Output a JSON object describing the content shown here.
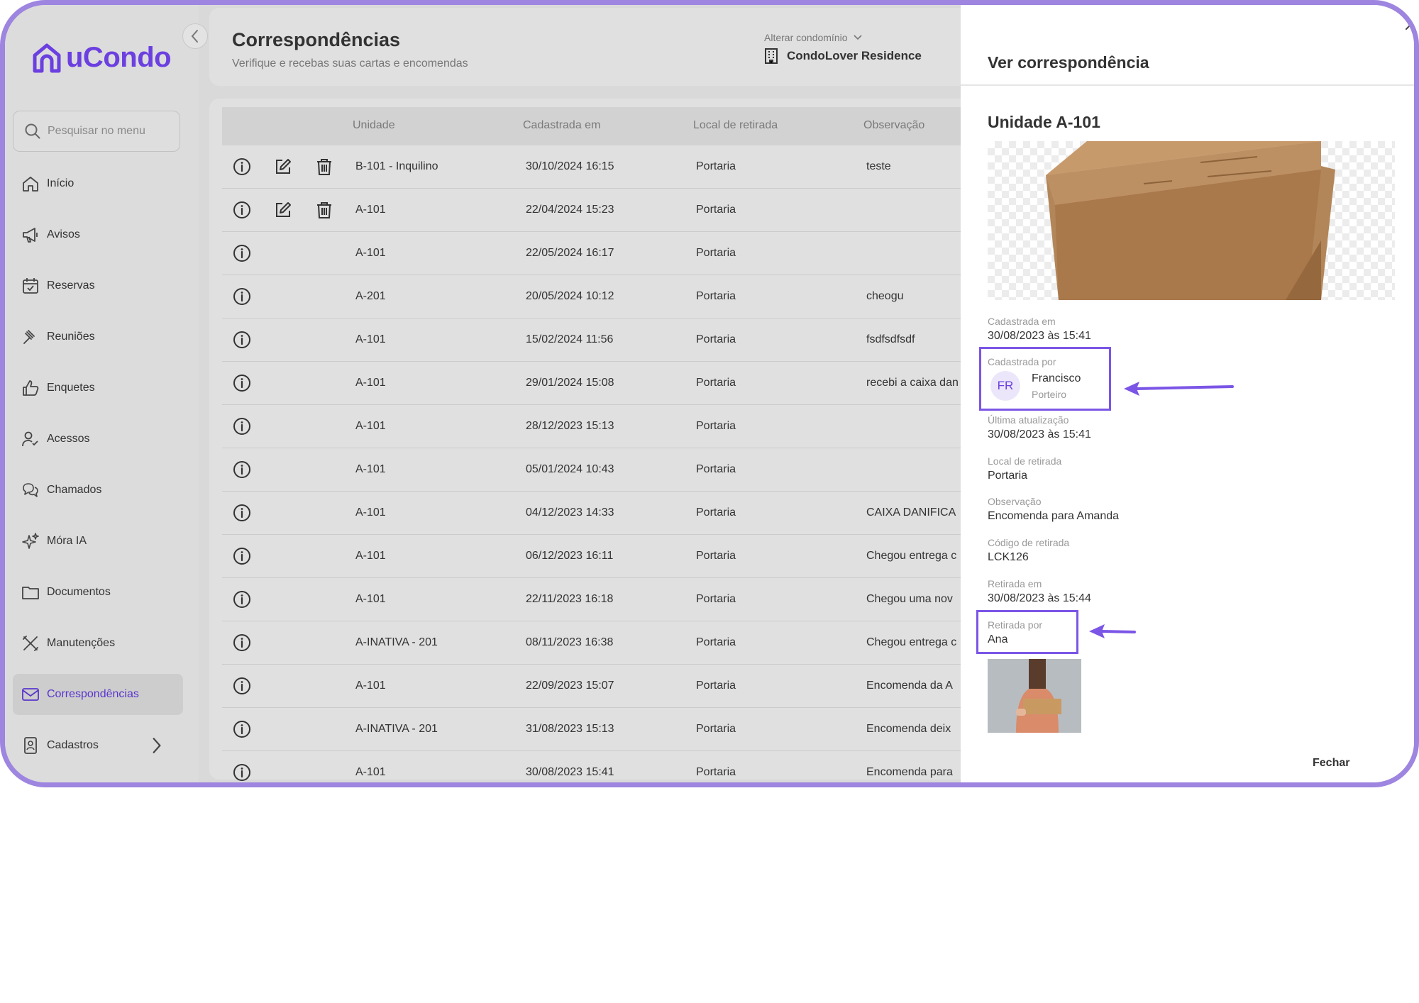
{
  "app": {
    "logo_text": "uCondo"
  },
  "sidebar": {
    "search_placeholder": "Pesquisar no menu",
    "items": [
      {
        "label": "Início",
        "icon": "home-icon"
      },
      {
        "label": "Avisos",
        "icon": "megaphone-icon"
      },
      {
        "label": "Reservas",
        "icon": "calendar-icon"
      },
      {
        "label": "Reuniões",
        "icon": "gavel-icon"
      },
      {
        "label": "Enquetes",
        "icon": "thumbs-up-icon"
      },
      {
        "label": "Acessos",
        "icon": "user-check-icon"
      },
      {
        "label": "Chamados",
        "icon": "chat-icon"
      },
      {
        "label": "Móra IA",
        "icon": "sparkles-icon"
      },
      {
        "label": "Documentos",
        "icon": "folder-icon"
      },
      {
        "label": "Manutenções",
        "icon": "tools-icon"
      },
      {
        "label": "Correspondências",
        "icon": "mail-icon",
        "active": true
      },
      {
        "label": "Cadastros",
        "icon": "id-card-icon"
      }
    ]
  },
  "header": {
    "title": "Correspondências",
    "subtitle": "Verifique e recebas suas cartas e encomendas",
    "condo_switch_label": "Alterar condomínio",
    "condo_name": "CondoLover Residence"
  },
  "table": {
    "columns": [
      "Unidade",
      "Cadastrada em",
      "Local de retirada",
      "Observação"
    ],
    "rows": [
      {
        "unit": "B-101 - Inquilino",
        "date": "30/10/2024 16:15",
        "place": "Portaria",
        "note": "teste",
        "editable": true
      },
      {
        "unit": "A-101",
        "date": "22/04/2024 15:23",
        "place": "Portaria",
        "note": "",
        "editable": true
      },
      {
        "unit": "A-101",
        "date": "22/05/2024 16:17",
        "place": "Portaria",
        "note": "",
        "editable": false
      },
      {
        "unit": "A-201",
        "date": "20/05/2024 10:12",
        "place": "Portaria",
        "note": "cheogu",
        "editable": false
      },
      {
        "unit": "A-101",
        "date": "15/02/2024 11:56",
        "place": "Portaria",
        "note": "fsdfsdfsdf",
        "editable": false
      },
      {
        "unit": "A-101",
        "date": "29/01/2024 15:08",
        "place": "Portaria",
        "note": "recebi a caixa dan",
        "editable": false
      },
      {
        "unit": "A-101",
        "date": "28/12/2023 15:13",
        "place": "Portaria",
        "note": "",
        "editable": false
      },
      {
        "unit": "A-101",
        "date": "05/01/2024 10:43",
        "place": "Portaria",
        "note": "",
        "editable": false
      },
      {
        "unit": "A-101",
        "date": "04/12/2023 14:33",
        "place": "Portaria",
        "note": "CAIXA DANIFICA",
        "editable": false
      },
      {
        "unit": "A-101",
        "date": "06/12/2023 16:11",
        "place": "Portaria",
        "note": "Chegou entrega c",
        "editable": false
      },
      {
        "unit": "A-101",
        "date": "22/11/2023 16:18",
        "place": "Portaria",
        "note": "Chegou uma nov",
        "editable": false
      },
      {
        "unit": "A-INATIVA - 201",
        "date": "08/11/2023 16:38",
        "place": "Portaria",
        "note": "Chegou entrega c",
        "editable": false
      },
      {
        "unit": "A-101",
        "date": "22/09/2023 15:07",
        "place": "Portaria",
        "note": "Encomenda da A",
        "editable": false
      },
      {
        "unit": "A-INATIVA - 201",
        "date": "31/08/2023 15:13",
        "place": "Portaria",
        "note": "Encomenda deix",
        "editable": false
      },
      {
        "unit": "A-101",
        "date": "30/08/2023 15:41",
        "place": "Portaria",
        "note": "Encomenda para",
        "editable": false
      }
    ]
  },
  "drawer": {
    "title": "Ver correspondência",
    "unit_title": "Unidade A-101",
    "registered_at_label": "Cadastrada em",
    "registered_at": "30/08/2023 às 15:41",
    "registered_by_label": "Cadastrada por",
    "registered_by_initials": "FR",
    "registered_by_name": "Francisco",
    "registered_by_role": "Porteiro",
    "updated_label": "Última atualização",
    "updated_at": "30/08/2023 às 15:41",
    "pickup_place_label": "Local de retirada",
    "pickup_place": "Portaria",
    "note_label": "Observação",
    "note": "Encomenda para Amanda",
    "code_label": "Código de retirada",
    "code": "LCK126",
    "picked_at_label": "Retirada em",
    "picked_at": "30/08/2023 às 15:44",
    "picked_by_label": "Retirada por",
    "picked_by": "Ana",
    "close_label": "Fechar"
  },
  "colors": {
    "accent": "#6b3fe0",
    "highlight": "#7b55e6",
    "frame": "#9d85e0"
  }
}
